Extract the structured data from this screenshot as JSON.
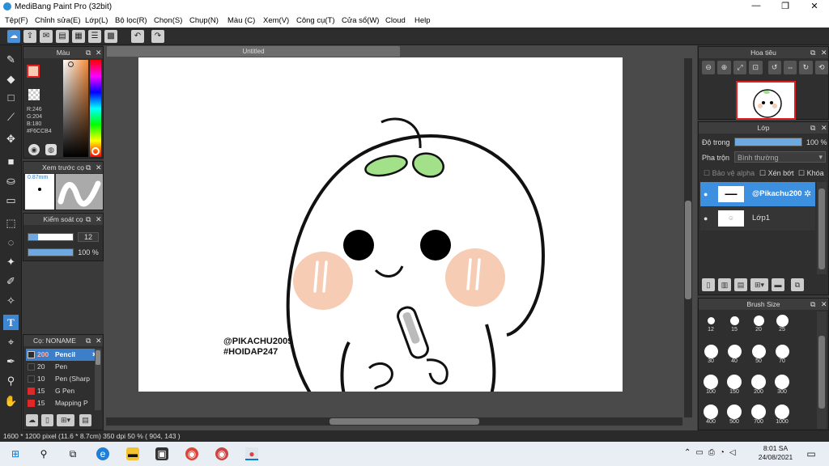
{
  "app": {
    "title": "MediBang Paint Pro (32bit)"
  },
  "menu": [
    "Tệp(F)",
    "Chỉnh sửa(E)",
    "Lớp(L)",
    "Bộ lọc(R)",
    "Chọn(S)",
    "Chụp(N)",
    "Màu (C)",
    "Xem(V)",
    "Công cụ(T)",
    "Cửa sổ(W)",
    "Cloud",
    "Help"
  ],
  "color_panel": {
    "title": "Màu",
    "r": "R:246",
    "g": "G:204",
    "b": "B:180",
    "hex": "#F6CCB4",
    "fg_color": "#f6ccb4",
    "accent_red": "#e82020"
  },
  "preview_panel": {
    "title": "Xem trước cọ",
    "size": "0.87mm"
  },
  "control_panel": {
    "title": "Kiểm soát cọ",
    "size_value": "12",
    "opacity_value": "100 %"
  },
  "brush_list": {
    "title": "Cọ: NONAME",
    "items": [
      {
        "size": "200",
        "name": "Pencil",
        "color": "#2b2b2b",
        "selected": true
      },
      {
        "size": "20",
        "name": "Pen",
        "color": "#2b2b2b",
        "selected": false
      },
      {
        "size": "10",
        "name": "Pen (Sharp",
        "color": "#2b2b2b",
        "selected": false
      },
      {
        "size": "15",
        "name": "G Pen",
        "color": "#e02828",
        "selected": false
      },
      {
        "size": "15",
        "name": "Mapping P",
        "color": "#e02828",
        "selected": false
      }
    ]
  },
  "document": {
    "tab": "Untitled"
  },
  "artwork": {
    "watermark_line1": "@PIKACHU2009",
    "watermark_line2": "#HOIDAP247"
  },
  "navigator": {
    "title": "Hoa tiêu"
  },
  "layer_panel": {
    "title": "Lớp",
    "opacity_label": "Độ trong",
    "opacity_value": "100 %",
    "blend_label": "Pha trộn",
    "blend_value": "Bình thường",
    "protect_alpha": "Bảo vệ alpha",
    "clipping": "Xén bớt",
    "lock": "Khóa",
    "layers": [
      {
        "name": "@Pikachu200",
        "selected": true
      },
      {
        "name": "Lớp1",
        "selected": false
      }
    ]
  },
  "brush_size_panel": {
    "title": "Brush Size",
    "sizes": [
      "12",
      "15",
      "20",
      "25",
      "30",
      "40",
      "50",
      "70",
      "100",
      "150",
      "200",
      "300",
      "400",
      "500",
      "700",
      "1000"
    ]
  },
  "status": {
    "text": "1600 * 1200 pixel   (11.6 * 8.7cm)   350 dpi   50 %   ( 904, 143 )"
  },
  "taskbar": {
    "time": "8:01 SA",
    "date": "24/08/2021"
  }
}
